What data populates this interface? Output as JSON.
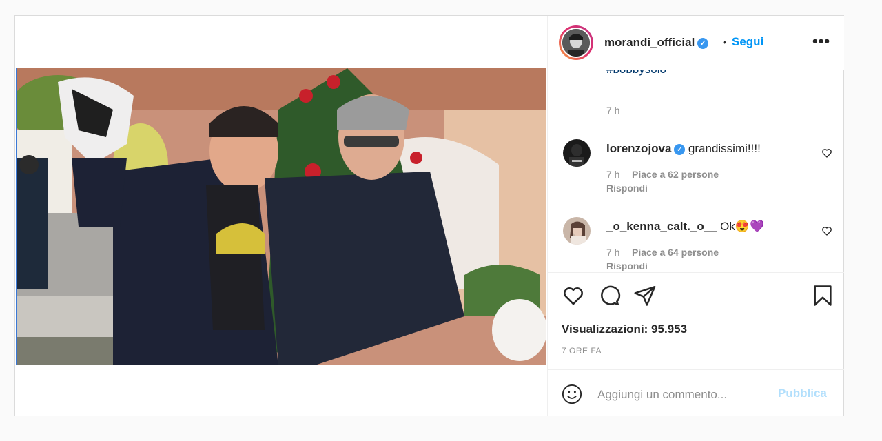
{
  "post": {
    "author": "morandi_official",
    "verified_mark": "✓",
    "separator": "•",
    "follow_label": "Segui",
    "more_label": "•••"
  },
  "comments_top": {
    "cutoff_hashtag": "#bobbysolo",
    "caption_time": "7 h"
  },
  "comments": [
    {
      "user": "lorenzojova",
      "verified": true,
      "text": "grandissimi!!!!",
      "time": "7 h",
      "likes": "Piace a 62 persone",
      "reply": "Rispondi"
    },
    {
      "user": "_o_kenna_calt._o__",
      "verified": false,
      "text": "Ok😍💜",
      "time": "7 h",
      "likes": "Piace a 64 persone",
      "reply": "Rispondi"
    }
  ],
  "actions": {
    "icons": [
      "heart-icon",
      "comment-icon",
      "share-icon",
      "bookmark-icon"
    ],
    "views": "Visualizzazioni: 95.953",
    "time_ago": "7 ORE FA"
  },
  "composer": {
    "placeholder": "Aggiungi un commento...",
    "publish_label": "Pubblica"
  },
  "colors": {
    "link_blue": "#0095f6",
    "verified_blue": "#3897f0",
    "publish_disabled": "#b2dffc",
    "text": "#262626",
    "muted": "#8e8e8e"
  }
}
